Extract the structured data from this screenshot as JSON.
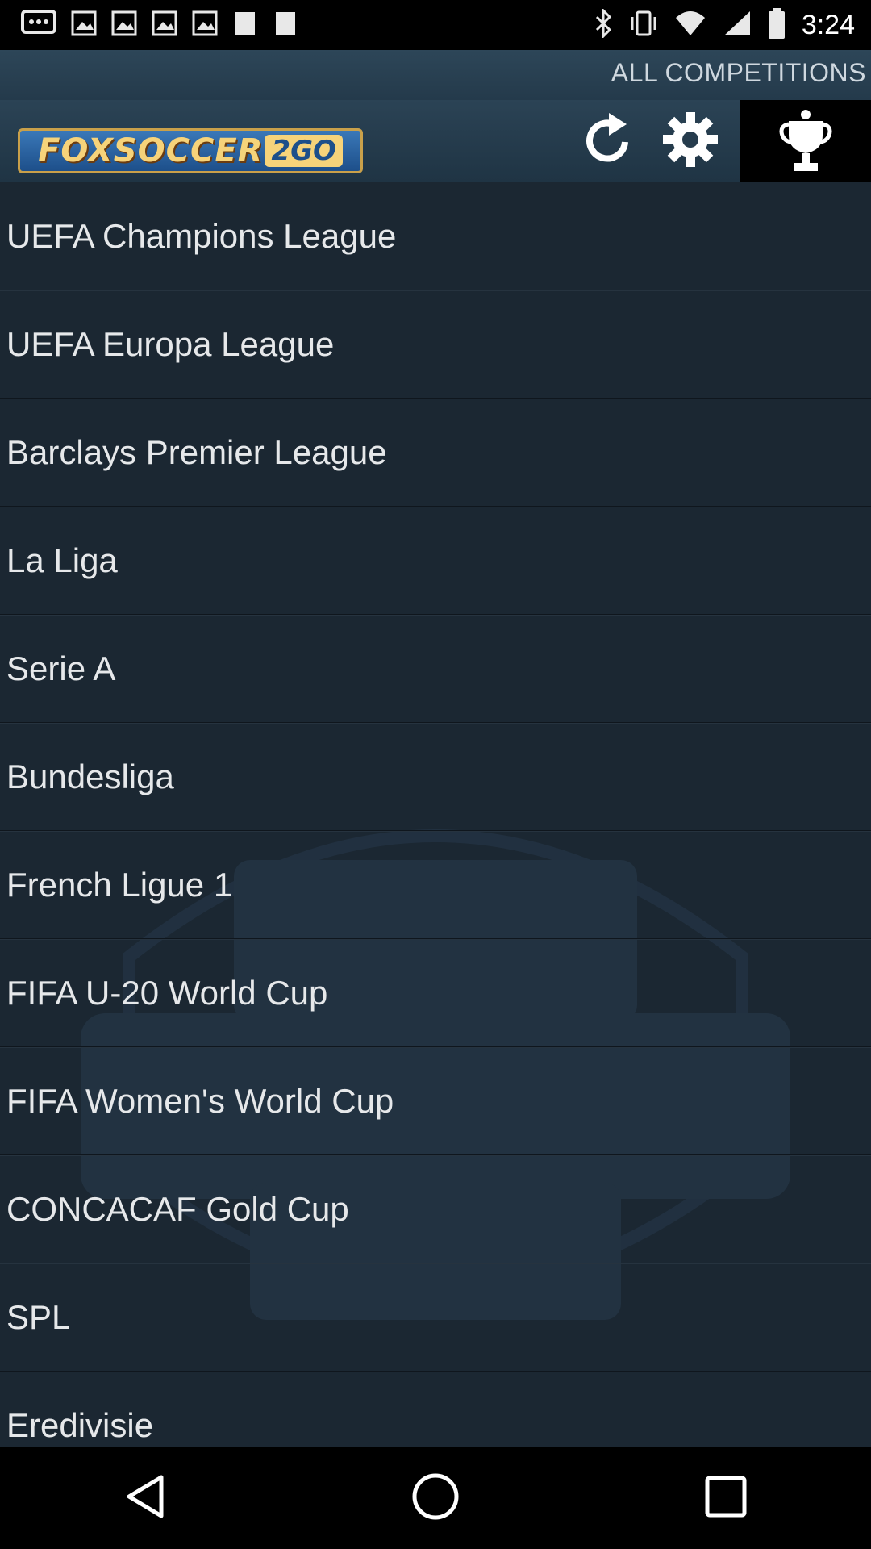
{
  "status_bar": {
    "time": "3:24",
    "icons": [
      "message-icon",
      "image-icon",
      "image-icon",
      "image-icon",
      "image-icon",
      "notification-icon",
      "notification-icon",
      "bluetooth-icon",
      "vibrate-icon",
      "wifi-icon",
      "signal-icon",
      "battery-icon"
    ]
  },
  "header": {
    "section_title": "ALL COMPETITIONS",
    "logo_text": "FOXSOCCER",
    "logo_badge": "2GO",
    "buttons": [
      "refresh-icon",
      "gear-icon",
      "trophy-icon"
    ]
  },
  "competitions": [
    {
      "label": "UEFA Champions League"
    },
    {
      "label": "UEFA Europa League"
    },
    {
      "label": "Barclays Premier League"
    },
    {
      "label": "La Liga"
    },
    {
      "label": "Serie A"
    },
    {
      "label": "Bundesliga"
    },
    {
      "label": "French Ligue 1"
    },
    {
      "label": "FIFA U-20 World Cup"
    },
    {
      "label": "FIFA Women's World Cup"
    },
    {
      "label": "CONCACAF Gold Cup"
    },
    {
      "label": "SPL"
    },
    {
      "label": "Eredivisie"
    }
  ],
  "nav": [
    "back-icon",
    "home-icon",
    "recents-icon"
  ],
  "colors": {
    "header_bg": "#2b4355",
    "list_bg": "#1b2732",
    "logo_gold": "#f6d37a"
  }
}
